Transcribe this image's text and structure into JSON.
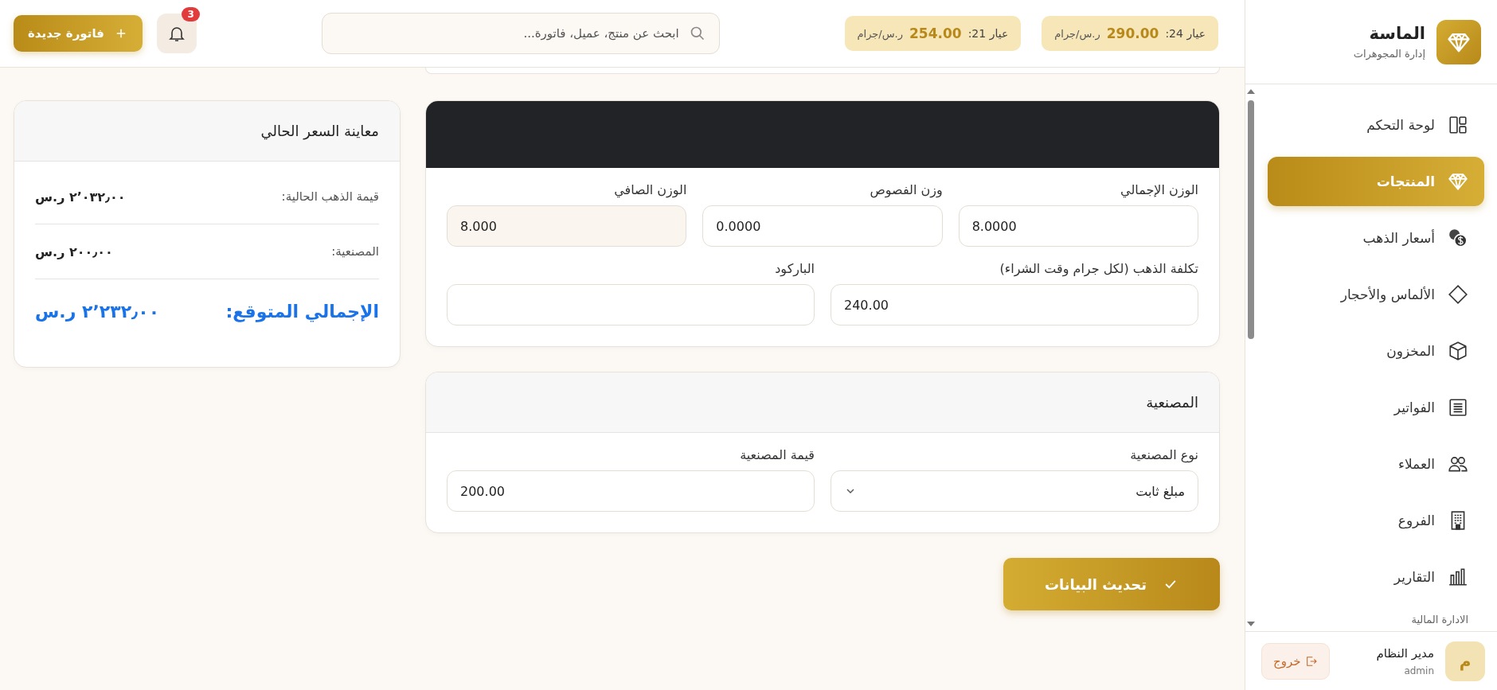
{
  "brand": {
    "name": "الماسة",
    "subtitle": "إدارة المجوهرات"
  },
  "sidebar": {
    "items": [
      {
        "label": "لوحة التحكم",
        "selected": false
      },
      {
        "label": "المنتجات",
        "selected": true
      },
      {
        "label": "أسعار الذهب",
        "selected": false
      },
      {
        "label": "الألماس والأحجار",
        "selected": false
      },
      {
        "label": "المخزون",
        "selected": false
      },
      {
        "label": "الفواتير",
        "selected": false
      },
      {
        "label": "العملاء",
        "selected": false
      },
      {
        "label": "الفروع",
        "selected": false
      },
      {
        "label": "التقارير",
        "selected": false
      }
    ],
    "section_label": "الادارة المالية",
    "user": {
      "initial": "م",
      "name": "مدير النظام",
      "role": "admin"
    },
    "logout": "خروج"
  },
  "header": {
    "gold_prices": [
      {
        "label": "عيار 24:",
        "price": "290.00",
        "unit": "ر.س/جرام"
      },
      {
        "label": "عيار 21:",
        "price": "254.00",
        "unit": "ر.س/جرام"
      }
    ],
    "search": {
      "placeholder": "ابحث عن منتج، عميل، فاتورة..."
    },
    "notifications": {
      "count": "3"
    },
    "new_invoice": "فاتورة جديدة"
  },
  "weights_card": {
    "rows": [
      {
        "fields": [
          {
            "label": "الوزن الإجمالي",
            "value": "8.0000",
            "readonly": false
          },
          {
            "label": "وزن الفصوص",
            "value": "0.0000",
            "readonly": false
          },
          {
            "label": "الوزن الصافي",
            "value": "8.000",
            "readonly": true
          }
        ]
      },
      {
        "fields": [
          {
            "label": "تكلفة الذهب (لكل جرام وقت الشراء)",
            "value": "240.00",
            "readonly": false
          },
          {
            "label": "الباركود",
            "readonly": false
          }
        ]
      }
    ]
  },
  "making_card": {
    "title": "المصنعية",
    "fields": [
      {
        "kind": "select",
        "label": "نوع المصنعية",
        "value": "مبلغ ثابت"
      },
      {
        "kind": "input",
        "label": "قيمة المصنعية",
        "value": "200.00"
      }
    ]
  },
  "submit": "تحديث البيانات",
  "preview": {
    "title": "معاينة السعر الحالي",
    "rows": [
      {
        "label": "قيمة الذهب الحالية:",
        "value": "٢٬٠٣٢٫٠٠ ر.س"
      },
      {
        "label": "المصنعية:",
        "value": "٢٠٠٫٠٠ ر.س"
      }
    ],
    "total": {
      "label": "الإجمالي المتوقع:",
      "value": "٢٬٢٣٢٫٠٠ ر.س"
    }
  }
}
